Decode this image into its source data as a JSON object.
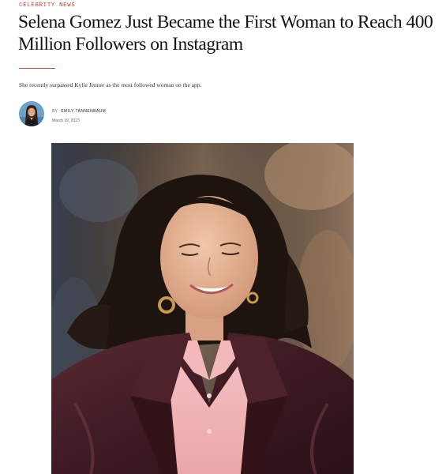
{
  "article": {
    "category": "CELEBRITY NEWS",
    "headline": "Selena Gomez Just Became the First Woman to Reach 400 Million Followers on Instagram",
    "dek": "She recently surpassed Kylie Jenner as the most followed woman on the app.",
    "byline_prefix": "BY",
    "author": "EMILY TANNENBAUM",
    "date": "March 19, 2023"
  },
  "colors": {
    "accent": "#d0452f"
  },
  "icons": {
    "avatar": "author-avatar-photo"
  }
}
